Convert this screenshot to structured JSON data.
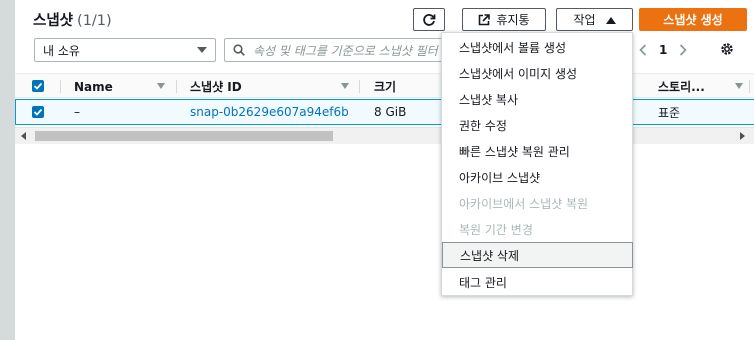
{
  "header": {
    "title": "스냅샷",
    "count": "(1/1)"
  },
  "toolbar": {
    "recycle_label": "휴지통",
    "action_label": "작업",
    "create_label": "스냅샷 생성"
  },
  "filter": {
    "ownership_value": "내 소유",
    "search_placeholder": "속성 및 태그를 기준으로 스냅샷 필터"
  },
  "pagination": {
    "current_page": "1"
  },
  "table": {
    "columns": [
      "Name",
      "스냅샷 ID",
      "크기",
      "스토리..."
    ],
    "rows": [
      {
        "name": "–",
        "snapshot_id": "snap-0b2629e607a94ef6b",
        "size": "8 GiB",
        "storage": "표준"
      }
    ]
  },
  "action_menu": {
    "items": [
      {
        "label": "스냅샷에서 볼륨 생성",
        "disabled": false
      },
      {
        "label": "스냅샷에서 이미지 생성",
        "disabled": false
      },
      {
        "label": "스냅샷 복사",
        "disabled": false
      },
      {
        "label": "권한 수정",
        "disabled": false
      },
      {
        "label": "빠른 스냅샷 복원 관리",
        "disabled": false
      },
      {
        "label": "아카이브 스냅샷",
        "disabled": false
      },
      {
        "label": "아카이브에서 스냅샷 복원",
        "disabled": true
      },
      {
        "label": "복원 기간 변경",
        "disabled": true
      },
      {
        "label": "스냅샷 삭제",
        "disabled": false,
        "highlighted": true
      },
      {
        "label": "태그 관리",
        "disabled": false
      }
    ]
  },
  "colors": {
    "primary_button": "#ec7211",
    "link": "#0073bb",
    "selected_row_bg": "#f1faff",
    "selected_row_border": "#00a1c9",
    "disabled_text": "#aab7b8"
  },
  "icons": [
    "refresh-icon",
    "external-link-icon",
    "caret-up-icon",
    "caret-down-icon",
    "search-icon",
    "chevron-left-icon",
    "chevron-right-icon",
    "gear-icon",
    "sort-icon",
    "checkbox-checked-icon"
  ]
}
